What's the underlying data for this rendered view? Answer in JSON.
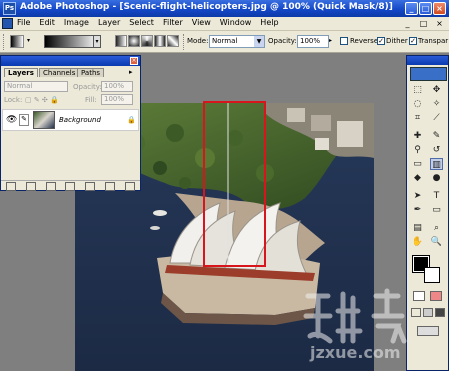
{
  "app": {
    "logo": "Ps",
    "window_title": "Adobe Photoshop - [Scenic-flight-helicopters.jpg @ 100% (Quick Mask/8)]",
    "window_buttons": [
      "_",
      "□",
      "×"
    ],
    "doc_buttons": [
      "_",
      "□",
      "×"
    ]
  },
  "menu": [
    "File",
    "Edit",
    "Image",
    "Layer",
    "Select",
    "Filter",
    "View",
    "Window",
    "Help"
  ],
  "options_bar": {
    "mode_label": "Mode:",
    "mode_value": "Normal",
    "opacity_label": "Opacity:",
    "opacity_value": "100%",
    "reverse_label": "Reverse",
    "reverse_checked": false,
    "dither_label": "Dither",
    "dither_checked": true,
    "transparency_label": "Transpar",
    "transparency_checked": true
  },
  "layers_panel": {
    "tabs": [
      "Layers",
      "Channels",
      "Paths"
    ],
    "active_tab": "Layers",
    "blend_mode": "Normal",
    "opacity_label": "Opacity:",
    "opacity_value": "100%",
    "lock_label": "Lock:",
    "fill_label": "Fill:",
    "fill_value": "100%",
    "layer_name": "Background"
  },
  "tools": [
    "move",
    "marquee",
    "lasso",
    "magic-wand",
    "crop",
    "slice",
    "healing",
    "brush",
    "stamp",
    "history-brush",
    "eraser",
    "gradient",
    "blur",
    "dodge",
    "path-select",
    "type",
    "pen",
    "shape",
    "notes",
    "eyedropper",
    "hand",
    "zoom"
  ],
  "colors": {
    "titlebar": "#1448c8",
    "chrome": "#ece9d8",
    "selection": "#d8141c",
    "workspace": "#7f7f7f"
  },
  "watermark": "jzxue.com"
}
